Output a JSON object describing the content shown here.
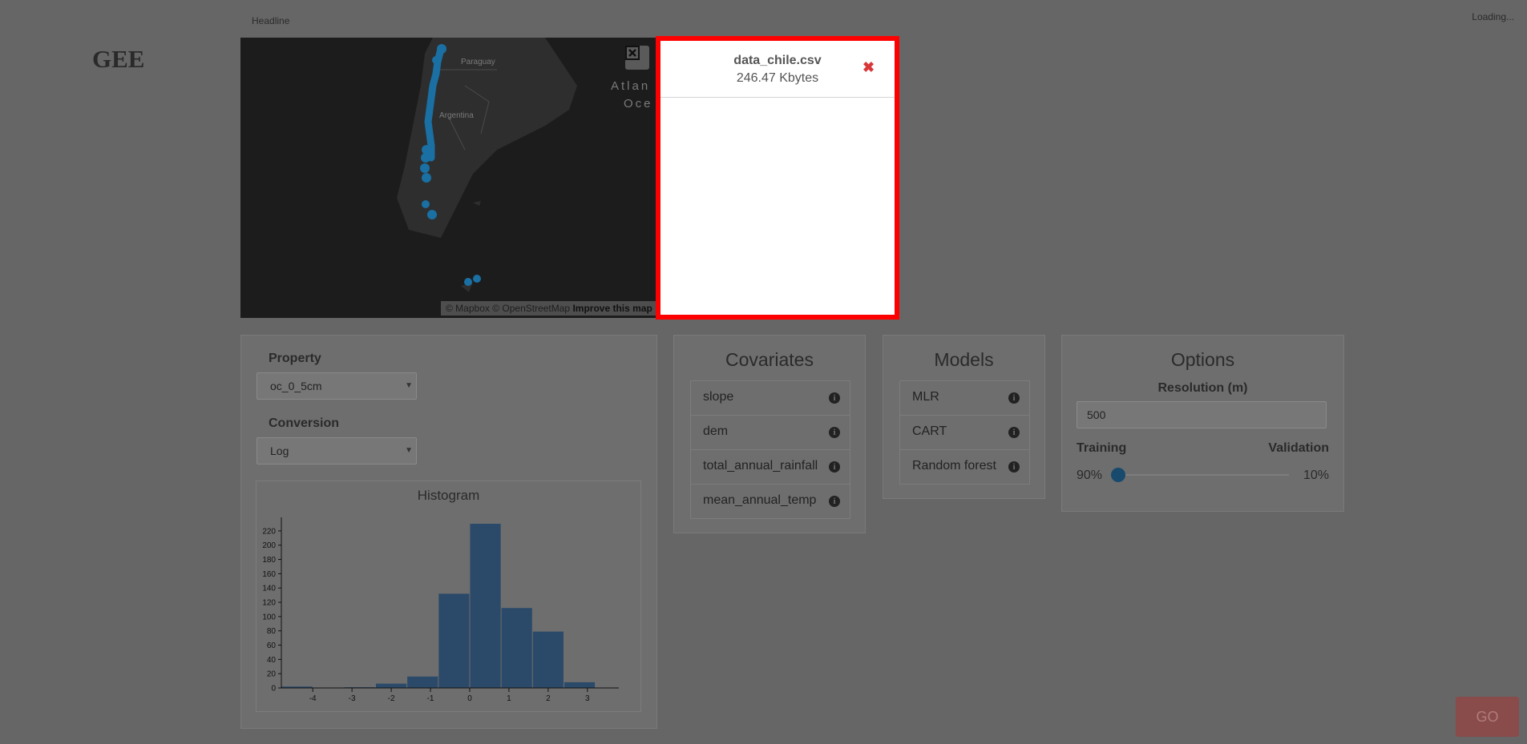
{
  "app": {
    "brand": "GEE",
    "headline": "Headline",
    "status": "Loading..."
  },
  "map": {
    "places": [
      "Paraguay",
      "Argentina",
      "Atlan",
      "Oce"
    ],
    "attribution": {
      "mapbox": "© Mapbox",
      "osm": "© OpenStreetMap",
      "improve": "Improve this map"
    },
    "fullscreen_icon": "fullscreen-icon"
  },
  "upload": {
    "file_name": "data_chile.csv",
    "file_size": "246.47 Kbytes",
    "close_icon": "close-x-icon"
  },
  "property_panel": {
    "property_label": "Property",
    "property_value": "oc_0_5cm",
    "conversion_label": "Conversion",
    "conversion_value": "Log"
  },
  "chart_data": {
    "type": "bar",
    "title": "Histogram",
    "xlabel": "",
    "ylabel": "",
    "x_ticks": [
      -4,
      -3,
      -2,
      -1,
      0,
      1,
      2,
      3
    ],
    "y_ticks": [
      0,
      20,
      40,
      60,
      80,
      100,
      120,
      140,
      160,
      180,
      200,
      220
    ],
    "bins": [
      {
        "x0": -4.8,
        "x1": -4.0,
        "count": 2
      },
      {
        "x0": -4.0,
        "x1": -3.2,
        "count": 0
      },
      {
        "x0": -3.2,
        "x1": -2.4,
        "count": 1
      },
      {
        "x0": -2.4,
        "x1": -1.6,
        "count": 6
      },
      {
        "x0": -1.6,
        "x1": -0.8,
        "count": 16
      },
      {
        "x0": -0.8,
        "x1": 0.0,
        "count": 132
      },
      {
        "x0": 0.0,
        "x1": 0.8,
        "count": 230
      },
      {
        "x0": 0.8,
        "x1": 1.6,
        "count": 112
      },
      {
        "x0": 1.6,
        "x1": 2.4,
        "count": 79
      },
      {
        "x0": 2.4,
        "x1": 3.2,
        "count": 8
      }
    ],
    "xlim": [
      -4.8,
      3.8
    ],
    "ylim": [
      0,
      230
    ],
    "bar_color": "#2b4a69",
    "grid": false
  },
  "covariates": {
    "title": "Covariates",
    "items": [
      {
        "label": "slope"
      },
      {
        "label": "dem"
      },
      {
        "label": "total_annual_rainfall"
      },
      {
        "label": "mean_annual_temp"
      }
    ]
  },
  "models": {
    "title": "Models",
    "items": [
      {
        "label": "MLR"
      },
      {
        "label": "CART"
      },
      {
        "label": "Random forest"
      }
    ]
  },
  "options": {
    "title": "Options",
    "resolution_label": "Resolution (m)",
    "resolution_value": "500",
    "training_label": "Training",
    "validation_label": "Validation",
    "training_pct": "90%",
    "validation_pct": "10%",
    "split_fraction": 0.9
  },
  "actions": {
    "go_label": "GO"
  },
  "colors": {
    "overlay": "#666666",
    "highlight_border": "#ff0000",
    "close": "#d9383a",
    "marker": "#1a6fa3",
    "go": "#8a4b4b"
  }
}
